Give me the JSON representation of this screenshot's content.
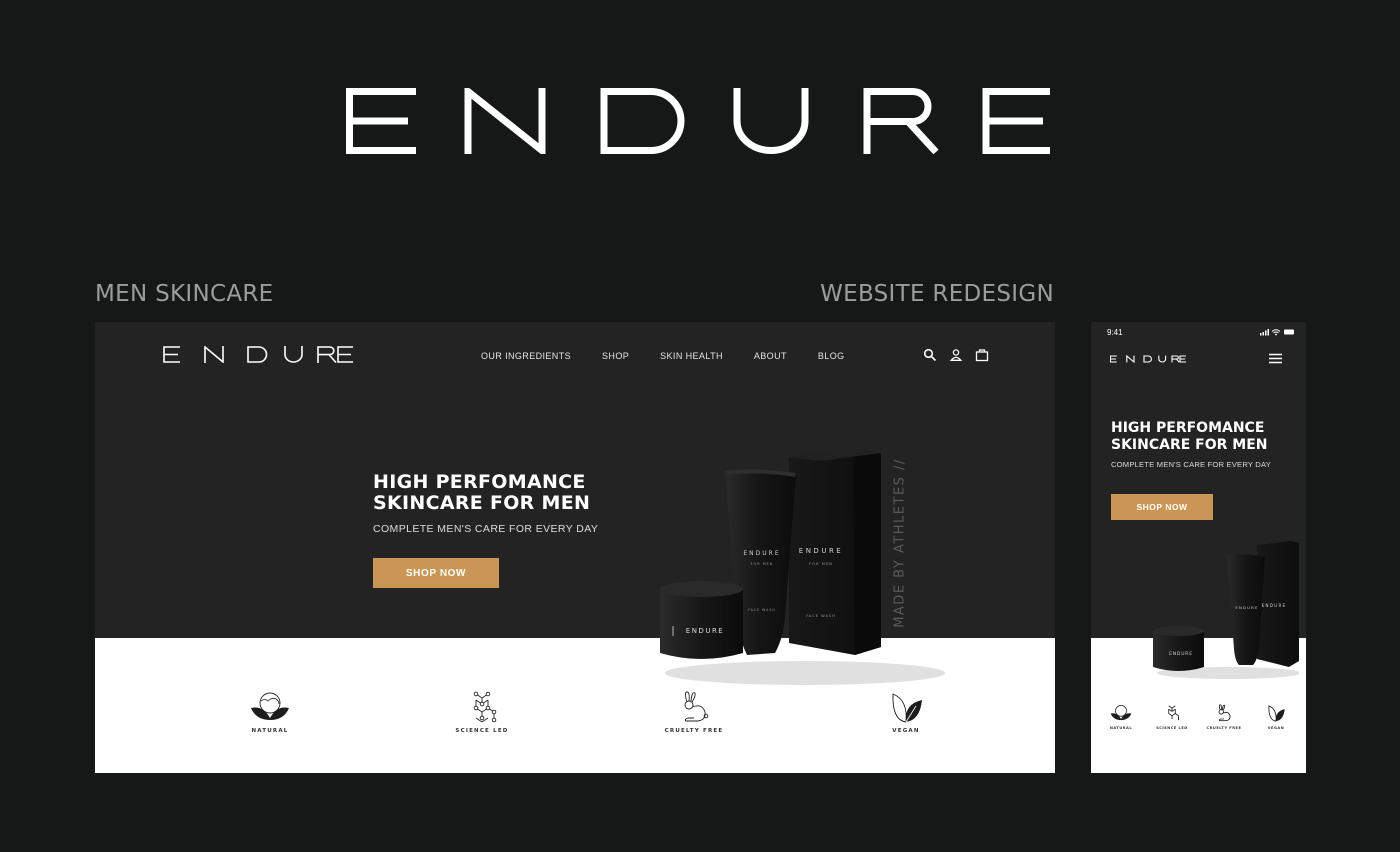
{
  "brand": {
    "name": "ENDURE",
    "tagline_left": "MEN SKINCARE",
    "tagline_right": "WEBSITE REDESIGN"
  },
  "colors": {
    "background": "#161818",
    "mockup_bg": "#232323",
    "accent": "#c99655",
    "white": "#ffffff"
  },
  "desktop": {
    "logo": "ENDURE",
    "nav": [
      "OUR INGREDIENTS",
      "SHOP",
      "SKIN HEALTH",
      "ABOUT",
      "BLOG"
    ],
    "icons": [
      "search-icon",
      "account-icon",
      "cart-icon"
    ],
    "hero": {
      "headline_line1": "HIGH PERFOMANCE",
      "headline_line2": "SKINCARE FOR MEN",
      "subheading": "COMPLETE MEN'S CARE FOR EVERY DAY",
      "cta": "SHOP NOW"
    },
    "product_side_text": "MADE BY ATHLETES //",
    "product_labels": {
      "brand": "ENDURE",
      "for_men": "FOR MEN",
      "face_wash": "FACE WASH"
    },
    "features": [
      {
        "label": "NATURAL",
        "icon": "globe-leaves-icon"
      },
      {
        "label": "SCIENCE LED",
        "icon": "molecule-icon"
      },
      {
        "label": "CRUELTY FREE",
        "icon": "rabbit-icon"
      },
      {
        "label": "VEGAN",
        "icon": "vegan-leaves-icon"
      }
    ]
  },
  "mobile": {
    "time": "9:41",
    "logo": "ENDURE",
    "hero": {
      "headline_line1": "HIGH PERFOMANCE",
      "headline_line2": "SKINCARE FOR MEN",
      "subheading": "COMPLETE MEN'S CARE FOR EVERY DAY",
      "cta": "SHOP NOW"
    },
    "features": [
      {
        "label": "NATURAL"
      },
      {
        "label": "SCIENCE LED"
      },
      {
        "label": "CRUELTY FREE"
      },
      {
        "label": "VEGAN"
      }
    ]
  }
}
